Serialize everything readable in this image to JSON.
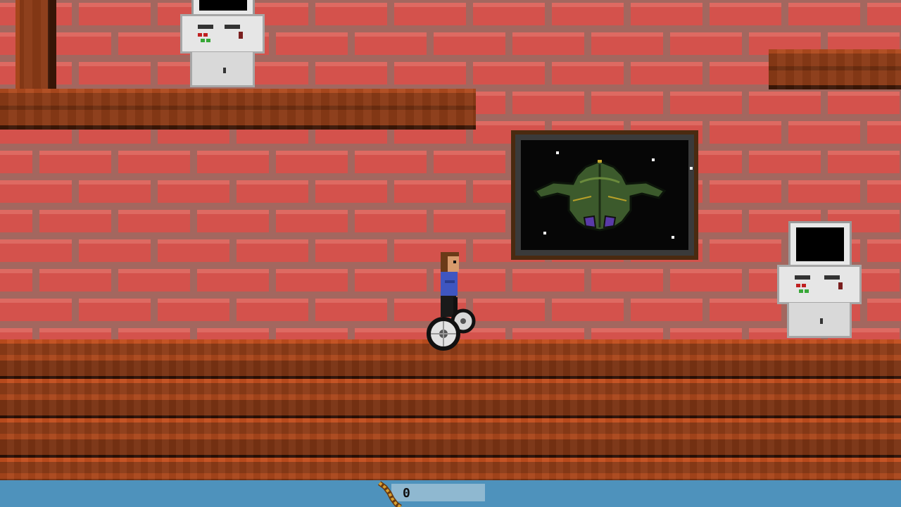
{
  "game": {
    "scene": "interior-room",
    "colors": {
      "brick": "#d4524c",
      "mortar": "#a3675f",
      "wood": "#8a3a16",
      "hud_bar": "#4e92bc",
      "hud_panel": "#8fb8d0"
    }
  },
  "hud": {
    "item_icon": "rope-icon",
    "count": "0"
  },
  "poster": {
    "subject": "alien-spaceship"
  }
}
